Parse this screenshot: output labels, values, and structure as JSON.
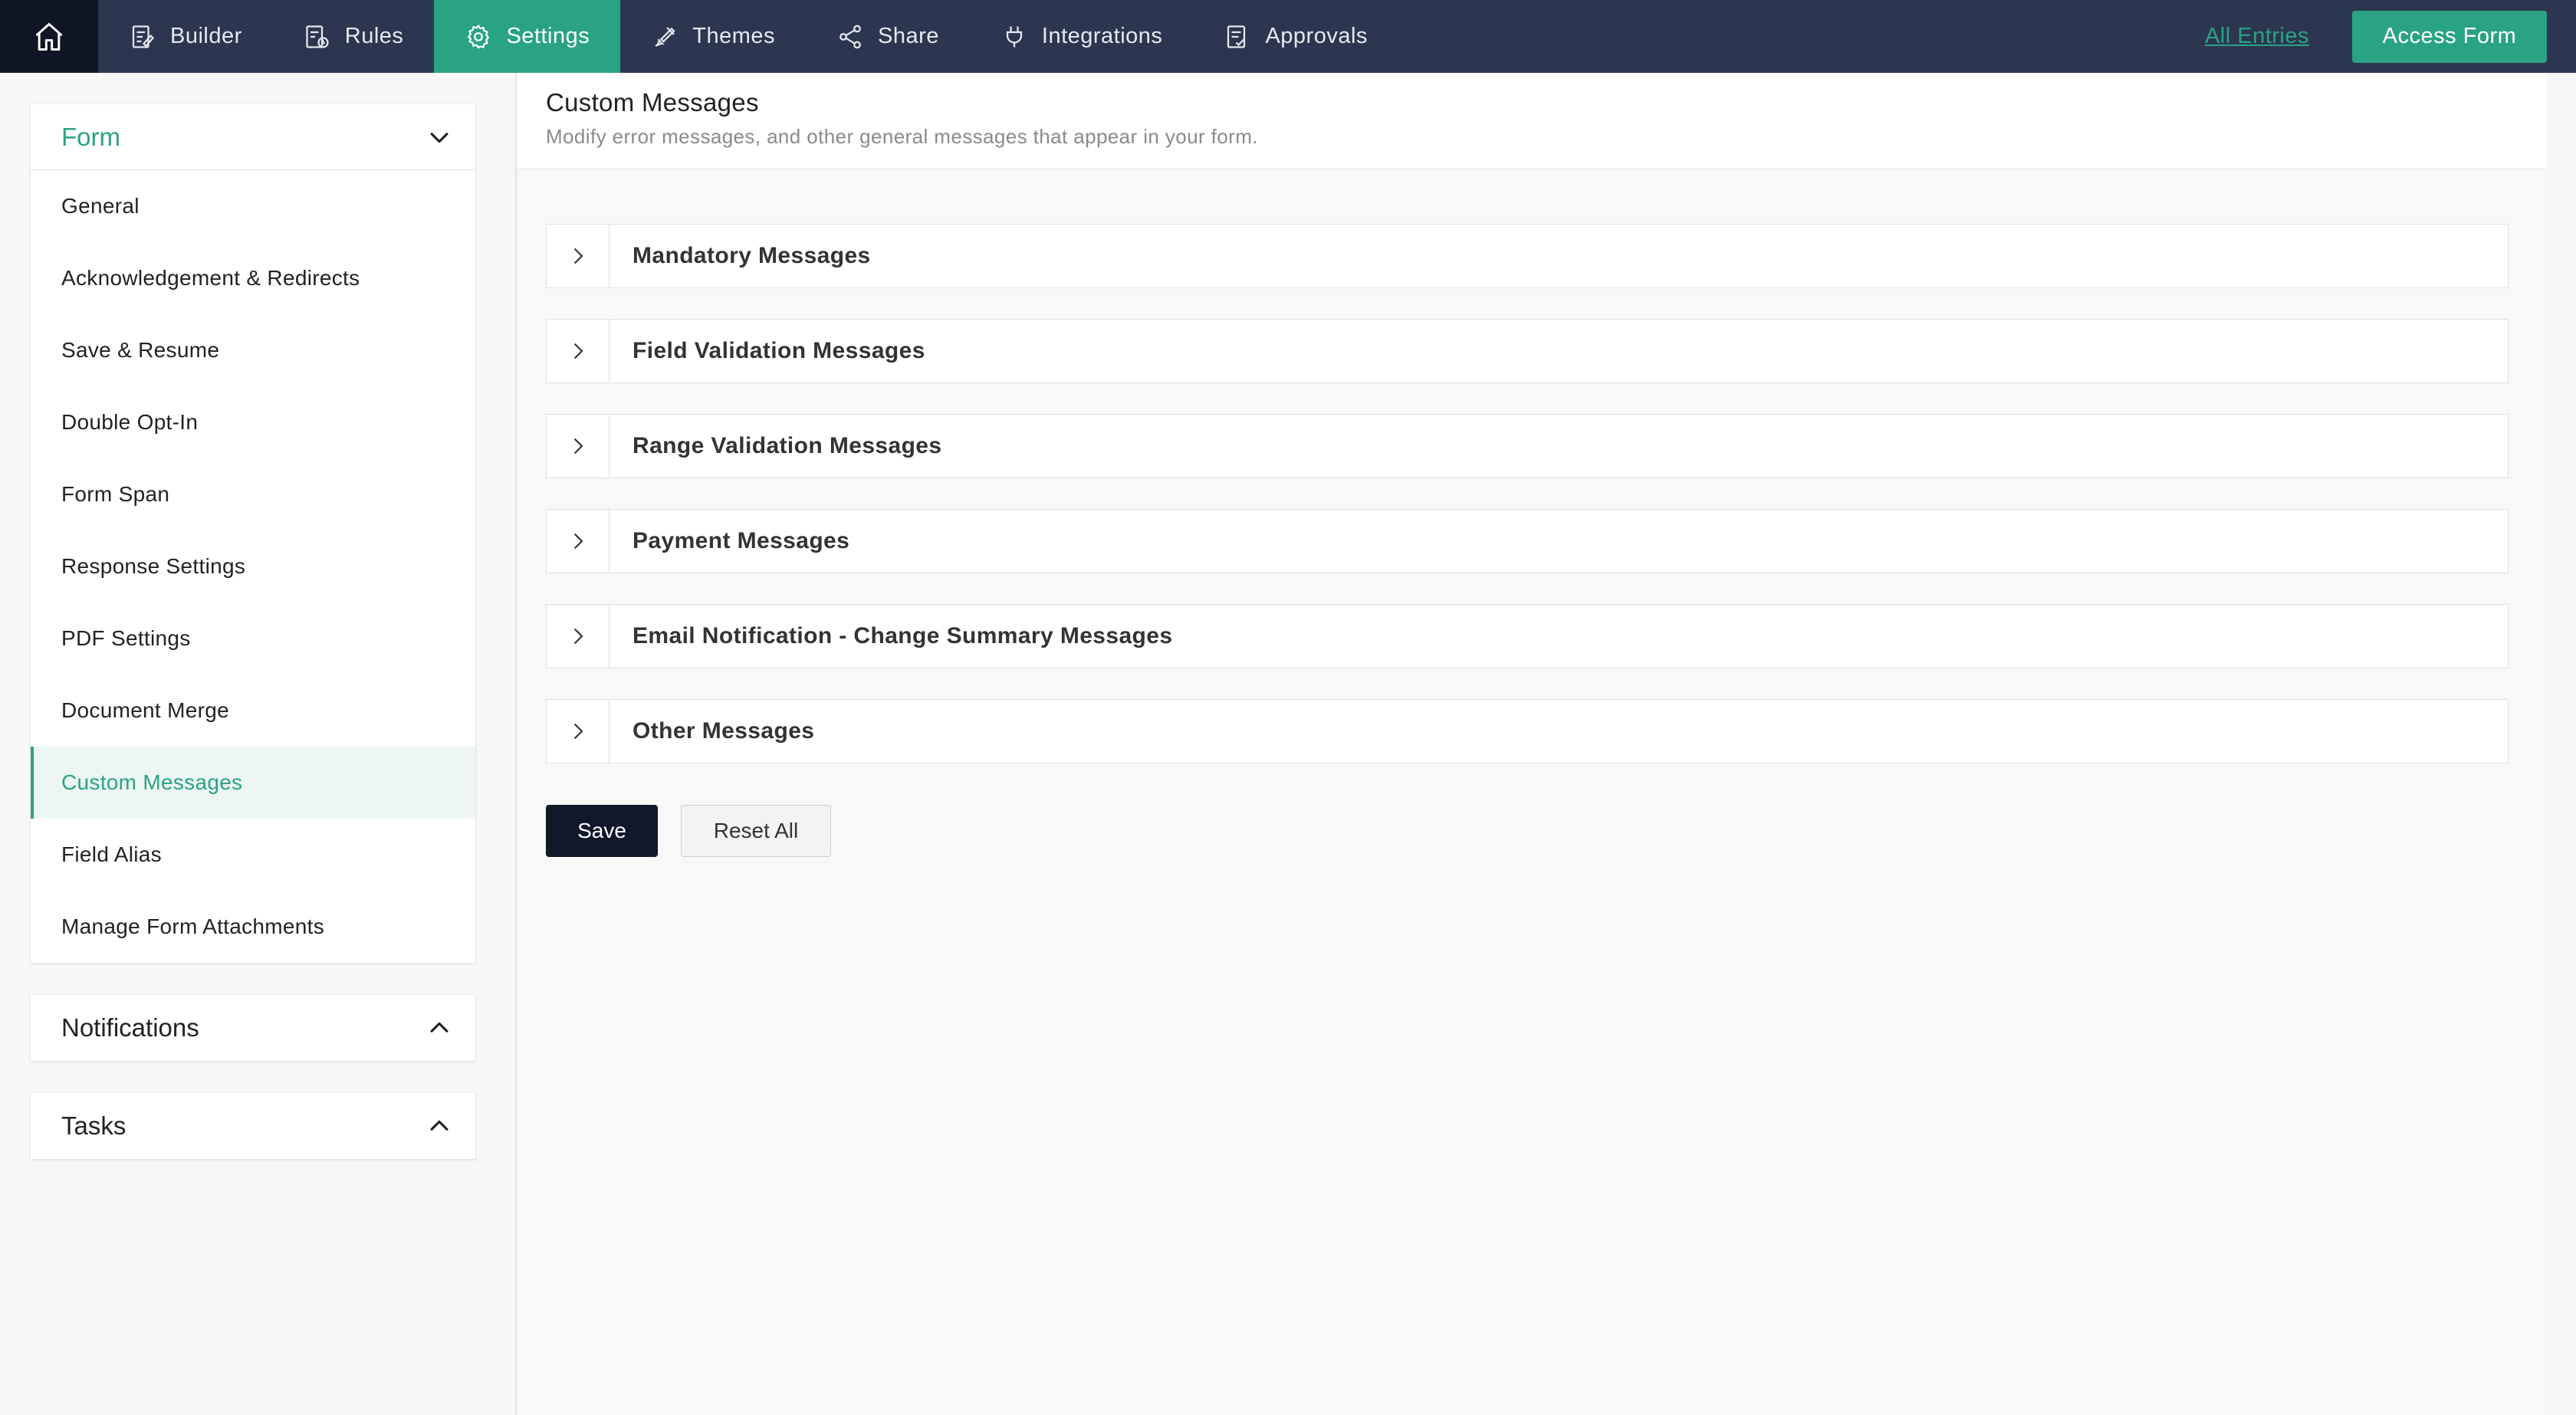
{
  "topnav": {
    "home_icon": "home-icon",
    "items": [
      {
        "label": "Builder",
        "icon": "builder-icon"
      },
      {
        "label": "Rules",
        "icon": "rules-icon"
      },
      {
        "label": "Settings",
        "icon": "gear-icon"
      },
      {
        "label": "Themes",
        "icon": "paint-brush-icon"
      },
      {
        "label": "Share",
        "icon": "share-icon"
      },
      {
        "label": "Integrations",
        "icon": "plug-icon"
      },
      {
        "label": "Approvals",
        "icon": "approvals-icon"
      }
    ],
    "active": "Settings",
    "all_entries": "All Entries",
    "access_form": "Access Form"
  },
  "sidebar": {
    "form_panel": {
      "title": "Form",
      "items": [
        {
          "label": "General"
        },
        {
          "label": "Acknowledgement & Redirects"
        },
        {
          "label": "Save & Resume"
        },
        {
          "label": "Double Opt-In"
        },
        {
          "label": "Form Span"
        },
        {
          "label": "Response Settings"
        },
        {
          "label": "PDF Settings"
        },
        {
          "label": "Document Merge"
        },
        {
          "label": "Custom Messages"
        },
        {
          "label": "Field Alias"
        },
        {
          "label": "Manage Form Attachments"
        }
      ],
      "active": "Custom Messages"
    },
    "notifications_panel": {
      "title": "Notifications"
    },
    "tasks_panel": {
      "title": "Tasks"
    }
  },
  "main": {
    "title": "Custom Messages",
    "subtitle": "Modify error messages, and other general messages that appear in your form.",
    "sections": [
      {
        "label": "Mandatory Messages"
      },
      {
        "label": "Field Validation Messages"
      },
      {
        "label": "Range Validation Messages"
      },
      {
        "label": "Payment Messages"
      },
      {
        "label": "Email Notification - Change Summary Messages"
      },
      {
        "label": "Other Messages"
      }
    ],
    "save_label": "Save",
    "reset_label": "Reset All"
  },
  "colors": {
    "accent": "#2aa384",
    "topbar": "#2c3650",
    "home_bg": "#0f1524",
    "save_bg": "#10182a"
  }
}
